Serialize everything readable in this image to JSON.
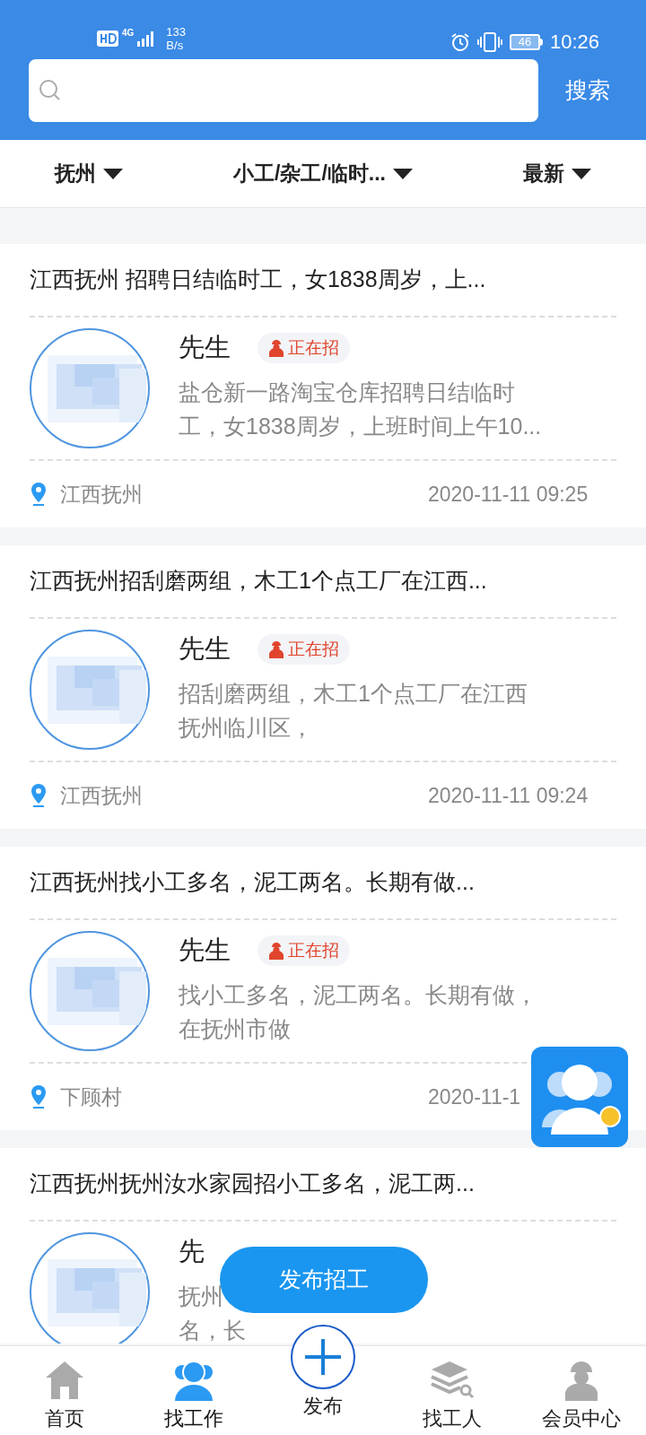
{
  "status_bar": {
    "network": "4G",
    "speed": "133",
    "speed_unit": "B/s",
    "battery": "46",
    "time": "10:26"
  },
  "search": {
    "button": "搜索"
  },
  "filters": [
    {
      "label": "抚州"
    },
    {
      "label": "小工/杂工/临时..."
    },
    {
      "label": "最新"
    }
  ],
  "jobs": [
    {
      "title": "江西抚州 招聘日结临时工，女1838周岁，上...",
      "name": "先生",
      "tag": "正在招",
      "body": [
        "盐仓新一路淘宝仓库招聘日结临时",
        "工，女1838周岁，上班时间上午10..."
      ],
      "location": "江西抚州",
      "date": "2020-11-11 09:25"
    },
    {
      "title": "江西抚州招刮磨两组，木工1个点工厂在江西...",
      "name": "先生",
      "tag": "正在招",
      "body": [
        "招刮磨两组，木工1个点工厂在江西",
        "抚州临川区，"
      ],
      "location": "江西抚州",
      "date": "2020-11-11 09:24"
    },
    {
      "title": "江西抚州找小工多名，泥工两名。长期有做...",
      "name": "先生",
      "tag": "正在招",
      "body": [
        "找小工多名，泥工两名。长期有做，",
        "在抚州市做"
      ],
      "location": "下顾村",
      "date": "2020-11-1"
    },
    {
      "title": "江西抚州抚州汝水家园招小工多名，泥工两...",
      "name": "先",
      "body": [
        "抚州",
        "名，长"
      ]
    }
  ],
  "post_button": "发布招工",
  "nav": [
    {
      "label": "首页",
      "kind": "home",
      "selected": false
    },
    {
      "label": "找工作",
      "kind": "people",
      "selected": true
    },
    {
      "label": "发布",
      "kind": "plus",
      "selected": false
    },
    {
      "label": "找工人",
      "kind": "stack",
      "selected": false
    },
    {
      "label": "会员中心",
      "kind": "worker",
      "selected": false
    }
  ]
}
